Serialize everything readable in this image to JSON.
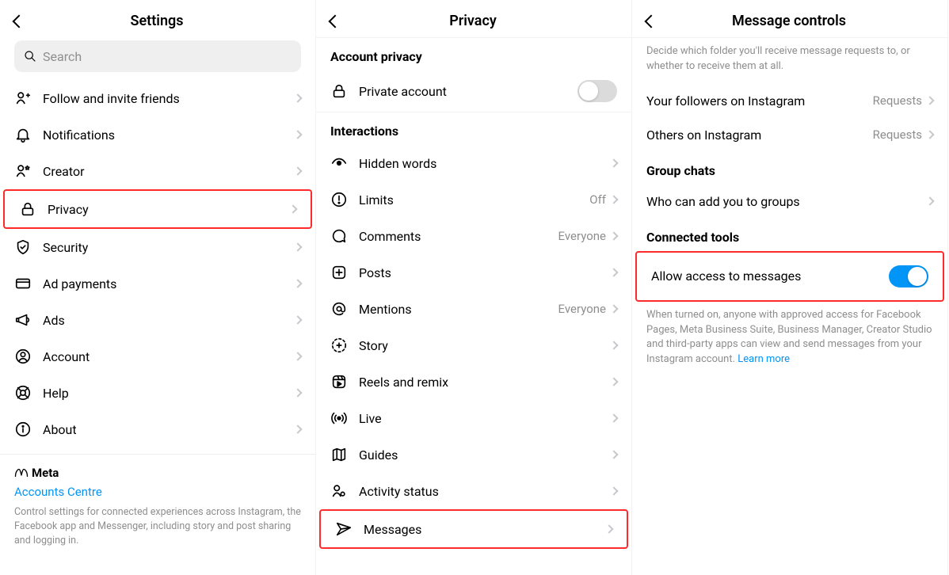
{
  "settings": {
    "title": "Settings",
    "search_placeholder": "Search",
    "items": {
      "follow": {
        "label": "Follow and invite friends"
      },
      "notif": {
        "label": "Notifications"
      },
      "creator": {
        "label": "Creator"
      },
      "privacy": {
        "label": "Privacy"
      },
      "security": {
        "label": "Security"
      },
      "adpay": {
        "label": "Ad payments"
      },
      "ads": {
        "label": "Ads"
      },
      "account": {
        "label": "Account"
      },
      "help": {
        "label": "Help"
      },
      "about": {
        "label": "About"
      }
    },
    "footer": {
      "brand": "Meta",
      "link": "Accounts Centre",
      "text": "Control settings for connected experiences across Instagram, the Facebook app and Messenger, including story and post sharing and logging in."
    }
  },
  "privacy": {
    "title": "Privacy",
    "section_account": "Account privacy",
    "section_interactions": "Interactions",
    "private_account": {
      "label": "Private account",
      "on": false
    },
    "items": {
      "hidden": {
        "label": "Hidden words",
        "value": ""
      },
      "limits": {
        "label": "Limits",
        "value": "Off"
      },
      "comments": {
        "label": "Comments",
        "value": "Everyone"
      },
      "posts": {
        "label": "Posts",
        "value": ""
      },
      "mentions": {
        "label": "Mentions",
        "value": "Everyone"
      },
      "story": {
        "label": "Story",
        "value": ""
      },
      "reels": {
        "label": "Reels and remix",
        "value": ""
      },
      "live": {
        "label": "Live",
        "value": ""
      },
      "guides": {
        "label": "Guides",
        "value": ""
      },
      "activity": {
        "label": "Activity status",
        "value": ""
      },
      "messages": {
        "label": "Messages",
        "value": ""
      }
    }
  },
  "message_controls": {
    "title": "Message controls",
    "top_text": "Decide which folder you'll receive message requests to, or whether to receive them at all.",
    "followers": {
      "label": "Your followers on Instagram",
      "value": "Requests"
    },
    "others": {
      "label": "Others on Instagram",
      "value": "Requests"
    },
    "section_group": "Group chats",
    "group_add": {
      "label": "Who can add you to groups"
    },
    "section_tools": "Connected tools",
    "allow_access": {
      "label": "Allow access to messages",
      "on": true
    },
    "tools_text": "When turned on, anyone with approved access for Facebook Pages, Meta Business Suite, Business Manager, Creator Studio and third-party apps can view and send messages from your Instagram account. ",
    "learn_more": "Learn more"
  }
}
